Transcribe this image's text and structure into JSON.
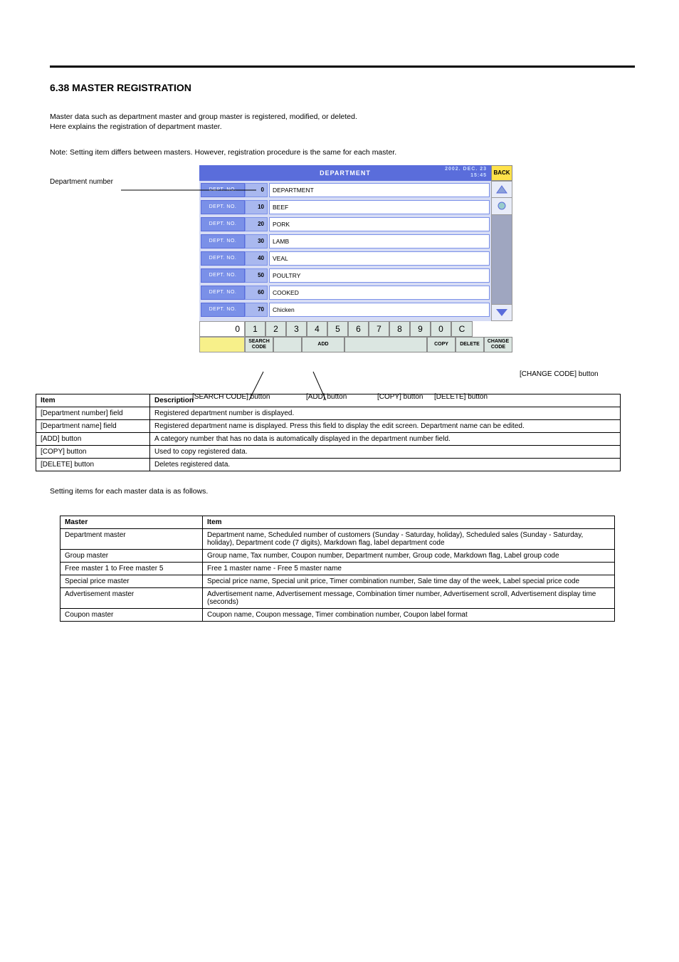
{
  "section_title": "6.38 MASTER REGISTRATION",
  "intro_line1": "Master data such as department master and group master is registered, modified, or deleted.",
  "intro_line2": "Here explains the registration of department master.",
  "intro_note": "Note: Setting item differs between masters. However, registration procedure is the same for each master.",
  "callout_left": "Department number",
  "callout_search": "[SEARCH CODE] button",
  "callout_add": "[ADD] button",
  "callout_copy": "[COPY] button",
  "callout_delete": "[DELETE] button",
  "callout_change": "[CHANGE CODE] button",
  "shot": {
    "title": "DEPARTMENT",
    "date1": "2002. DEC. 23",
    "date2": "15:45",
    "back": "BACK",
    "row_label": "DEPT. NO.",
    "rows": [
      {
        "n": "0",
        "v": "DEPARTMENT"
      },
      {
        "n": "10",
        "v": "BEEF"
      },
      {
        "n": "20",
        "v": "PORK"
      },
      {
        "n": "30",
        "v": "LAMB"
      },
      {
        "n": "40",
        "v": "VEAL"
      },
      {
        "n": "50",
        "v": "POULTRY"
      },
      {
        "n": "60",
        "v": "COOKED"
      },
      {
        "n": "70",
        "v": "Chicken"
      }
    ],
    "kp_display": "0",
    "kp_keys": [
      "1",
      "2",
      "3",
      "4",
      "5",
      "6",
      "7",
      "8",
      "9",
      "0"
    ],
    "kp_c": "C",
    "fn_search": "SEARCH\nCODE",
    "fn_add": "ADD",
    "fn_copy": "COPY",
    "fn_delete": "DELETE",
    "fn_change": "CHANGE\nCODE"
  },
  "t1": {
    "h1": "Item",
    "h2": "Description",
    "r1c1": "[Department number] field",
    "r1c2": "Registered department number is displayed.",
    "r2c1": "[Department name] field",
    "r2c2": "Registered department name is displayed. Press this field to display the edit screen. Department name can be edited.",
    "r3c1": "[ADD] button",
    "r3c2": "A category number that has no data is automatically displayed in the department number field.",
    "r4c1": "[COPY] button",
    "r4c2": "Used to copy registered data.",
    "r5c1": "[DELETE] button",
    "r5c2": "Deletes registered data."
  },
  "mid_text": "Setting items for each master data is as follows.",
  "t2": {
    "h1": "Master",
    "h2": "Item",
    "r1c1": "Department master",
    "r1c2": "Department name, Scheduled number of customers (Sunday - Saturday, holiday), Scheduled sales (Sunday - Saturday, holiday), Department code (7 digits), Markdown flag, label department code",
    "r2c1": "Group master",
    "r2c2": "Group name, Tax number, Coupon number, Department number, Group code, Markdown flag, Label group code",
    "r3c1": "Free master 1 to Free master 5",
    "r3c2": "Free 1 master name - Free 5 master name",
    "r4c1": "Special price master",
    "r4c2": "Special price name, Special unit price, Timer combination number, Sale time day of the week, Label special price code",
    "r5c1": "Advertisement master",
    "r5c2": "Advertisement name, Advertisement message, Combination timer number, Advertisement scroll, Advertisement display time (seconds)",
    "r6c1": "Coupon master",
    "r6c2": "Coupon name, Coupon message, Timer combination number, Coupon label format"
  }
}
